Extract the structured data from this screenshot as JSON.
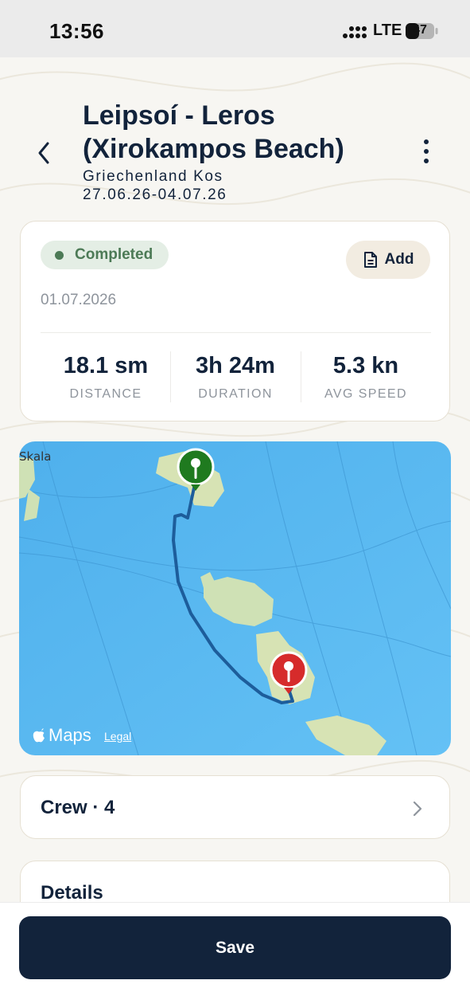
{
  "status_bar": {
    "time": "13:56",
    "network": "LTE",
    "battery": "47",
    "signal_icon": "cellular-signal-icon",
    "battery_icon": "battery-icon"
  },
  "header": {
    "back_icon": "chevron-left-icon",
    "title_line1": "Leipsoí - Leros",
    "title_line2": "(Xirokampos Beach)",
    "region": "Griechenland Kos",
    "date_range": "27.06.26-04.07.26",
    "more_icon": "vertical-ellipsis-icon"
  },
  "trip": {
    "status": "Completed",
    "status_color": "#4c7a56",
    "add_label": "Add",
    "add_icon": "document-icon",
    "date": "01.07.2026",
    "stats": [
      {
        "value": "18.1 sm",
        "label": "DISTANCE"
      },
      {
        "value": "3h 24m",
        "label": "DURATION"
      },
      {
        "value": "5.3 kn",
        "label": "AVG SPEED"
      }
    ]
  },
  "map": {
    "place_label": "Skala",
    "provider": "Maps",
    "legal": "Legal",
    "start_pin_color": "#1f7a1f",
    "end_pin_color": "#d62b2b",
    "route_color": "#1d5d9b"
  },
  "crew": {
    "label": "Crew · 4",
    "chevron_icon": "chevron-right-icon"
  },
  "details": {
    "label": "Details"
  },
  "footer": {
    "save_label": "Save"
  },
  "colors": {
    "primary": "#12233b",
    "background": "#f7f6f2",
    "sea": "#5ab8f0"
  }
}
